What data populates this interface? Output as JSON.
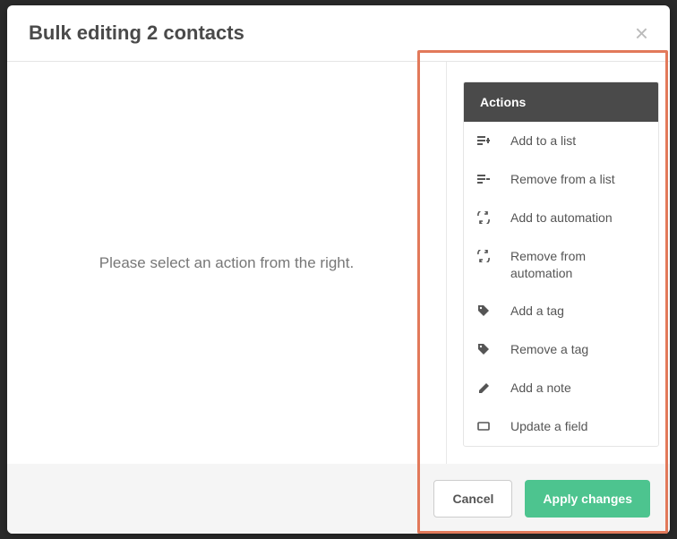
{
  "header": {
    "title": "Bulk editing 2 contacts"
  },
  "main": {
    "placeholder": "Please select an action from the right."
  },
  "sidebar": {
    "header": "Actions",
    "items": [
      {
        "icon": "list-add",
        "label": "Add to a list"
      },
      {
        "icon": "list-remove",
        "label": "Remove from a list"
      },
      {
        "icon": "automation-add",
        "label": "Add to automation"
      },
      {
        "icon": "automation-remove",
        "label": "Remove from automation"
      },
      {
        "icon": "tag-add",
        "label": "Add a tag"
      },
      {
        "icon": "tag-remove",
        "label": "Remove a tag"
      },
      {
        "icon": "note",
        "label": "Add a note"
      },
      {
        "icon": "field",
        "label": "Update a field"
      }
    ]
  },
  "footer": {
    "cancel": "Cancel",
    "apply": "Apply changes"
  }
}
